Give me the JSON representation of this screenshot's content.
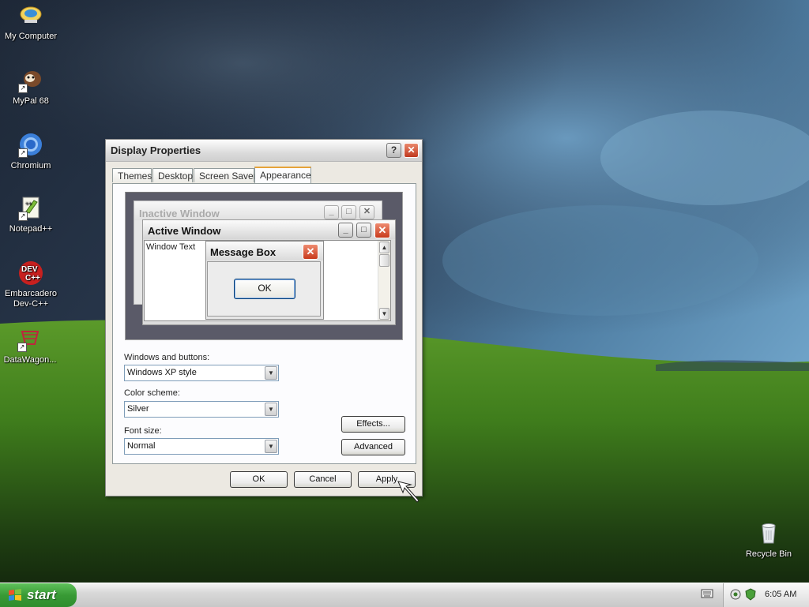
{
  "desktop": {
    "icons": [
      {
        "label": "My Computer",
        "icon": "my-computer-icon"
      },
      {
        "label": "MyPal 68",
        "icon": "mypal-icon"
      },
      {
        "label": "Chromium",
        "icon": "chromium-icon"
      },
      {
        "label": "Notepad++",
        "icon": "notepadpp-icon"
      },
      {
        "label": "Embarcadero Dev-C++",
        "icon": "devcpp-icon"
      },
      {
        "label": "DataWagon...",
        "icon": "datawagon-icon"
      },
      {
        "label": "Recycle Bin",
        "icon": "recycle-bin-icon"
      }
    ]
  },
  "dialog": {
    "title": "Display Properties",
    "help_glyph": "?",
    "close_glyph": "✕",
    "tabs": [
      {
        "label": "Themes",
        "active": false
      },
      {
        "label": "Desktop",
        "active": false
      },
      {
        "label": "Screen Saver",
        "active": false
      },
      {
        "label": "Appearance",
        "active": true
      }
    ],
    "preview": {
      "inactive_title": "Inactive Window",
      "active_title": "Active Window",
      "window_text": "Window Text",
      "message_title": "Message Box",
      "ok_label": "OK"
    },
    "fields": {
      "windows_buttons_label": "Windows and buttons:",
      "windows_buttons_value": "Windows XP style",
      "color_scheme_label": "Color scheme:",
      "color_scheme_value": "Silver",
      "font_size_label": "Font size:",
      "font_size_value": "Normal"
    },
    "buttons": {
      "effects": "Effects...",
      "advanced": "Advanced",
      "ok": "OK",
      "cancel": "Cancel",
      "apply": "Apply"
    }
  },
  "taskbar": {
    "start_label": "start",
    "clock": "6:05 AM"
  },
  "colors": {
    "accent_tab": "#e6a33a",
    "start_green": "#389a35",
    "close_red": "#c83a1c"
  }
}
